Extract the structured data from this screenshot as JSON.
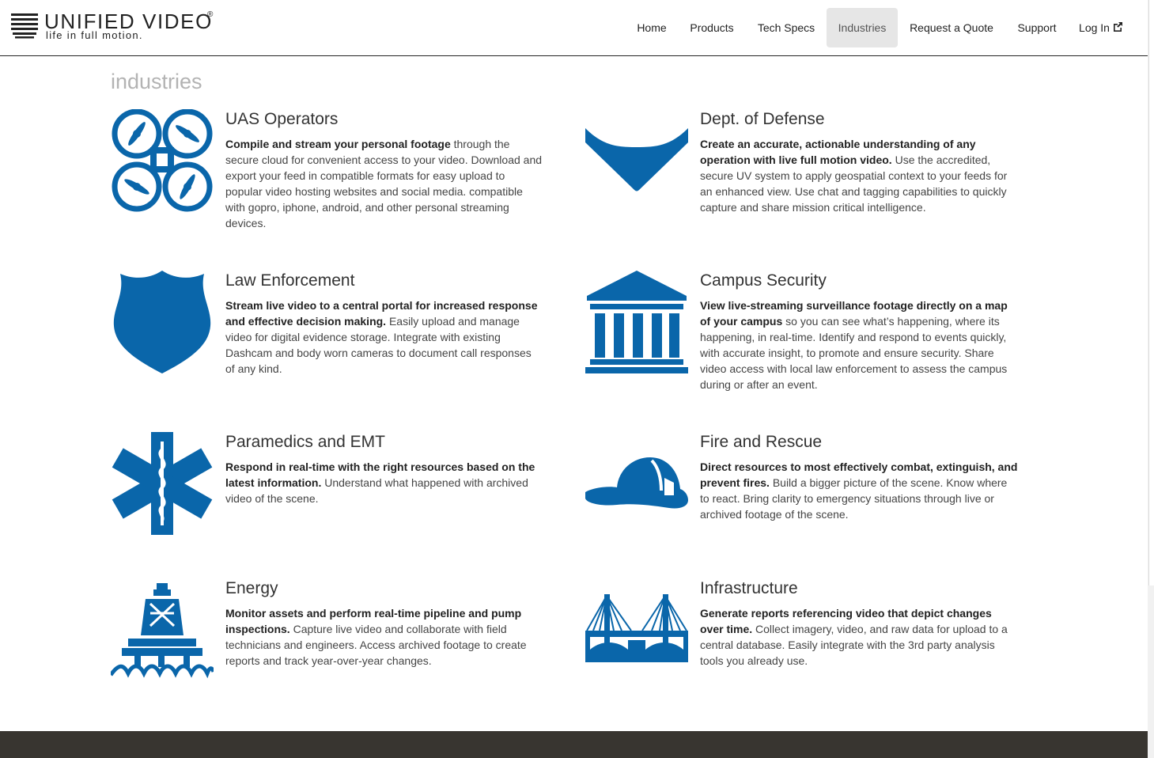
{
  "brand": {
    "name": "UNIFIED VIDEO",
    "registered": "®",
    "tagline": "life in full motion."
  },
  "nav": {
    "items": [
      {
        "label": "Home"
      },
      {
        "label": "Products"
      },
      {
        "label": "Tech Specs"
      },
      {
        "label": "Industries",
        "active": true
      },
      {
        "label": "Request a Quote"
      },
      {
        "label": "Support"
      },
      {
        "label": "Log In"
      }
    ],
    "login_icon": "external-link-icon"
  },
  "page": {
    "title": "industries"
  },
  "colors": {
    "icon_blue": "#0a66aa",
    "footer": "#383530",
    "active_nav_bg": "#e6e6e6"
  },
  "industries": [
    {
      "title": "UAS Operators",
      "lead": "Compile and stream your personal footage",
      "body": " through the secure cloud for convenient access to your video. Download and export your feed in compatible formats for easy upload to popular video hosting websites and social media. compatible with gopro, iphone, android, and other personal streaming devices.",
      "icon": "quadcopter-icon"
    },
    {
      "title": "Dept. of Defense",
      "lead": "Create an accurate, actionable understanding of any operation with live full motion video.",
      "body": " Use the accredited, secure UV system to apply geospatial context to your feeds for an enhanced view. Use chat and tagging capabilities to quickly capture and share mission critical intelligence.",
      "icon": "chevron-insignia-icon"
    },
    {
      "title": "Law Enforcement",
      "lead": "Stream live video to a central portal for increased response and effective decision making.",
      "body": " Easily upload and manage video for digital evidence storage. Integrate with existing Dashcam and body worn cameras to document call responses of any kind.",
      "icon": "police-badge-icon"
    },
    {
      "title": "Campus Security",
      "lead": "View live-streaming surveillance footage directly on a map of your campus",
      "body": " so you can see what’s happening, where its happening, in real-time. Identify and respond to events quickly, with accurate insight, to promote and ensure security. Share video access with local law enforcement to assess the campus during or after an event.",
      "icon": "campus-building-icon"
    },
    {
      "title": "Paramedics and EMT",
      "lead": "Respond in real-time with the right resources based on the latest information.",
      "body": " Understand what happened with archived video of the scene.",
      "icon": "star-of-life-icon"
    },
    {
      "title": "Fire and Rescue",
      "lead": "Direct resources to most effectively combat, extinguish, and prevent fires.",
      "body": " Build a bigger picture of the scene. Know where to react. Bring clarity to emergency situations through live or archived footage of the scene.",
      "icon": "fire-helmet-icon"
    },
    {
      "title": "Energy",
      "lead": "Monitor assets and perform real-time pipeline and pump inspections.",
      "body": " Capture live video and collaborate with field technicians and engineers. Access archived footage to create reports and track year-over-year changes.",
      "icon": "oil-rig-icon"
    },
    {
      "title": "Infrastructure",
      "lead": "Generate reports referencing video that depict changes over time.",
      "body": " Collect imagery, video, and raw data for upload to a central database. Easily integrate with the 3rd party analysis tools you already use.",
      "icon": "bridge-icon"
    }
  ]
}
